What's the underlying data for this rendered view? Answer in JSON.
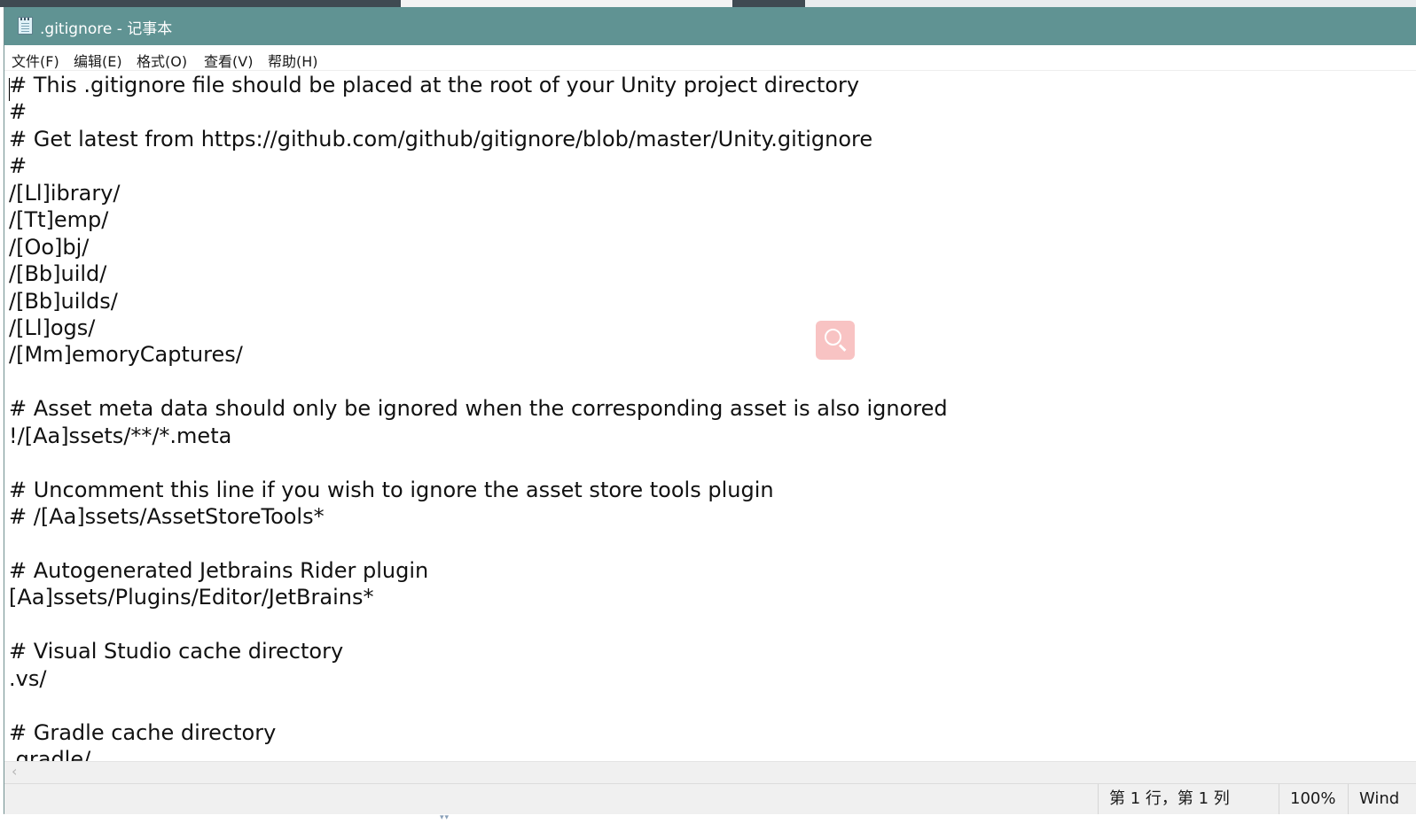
{
  "window": {
    "title": ".gitignore - 记事本",
    "titlebar_color": "#609393"
  },
  "menu": [
    {
      "label": "文件(F)"
    },
    {
      "label": "编辑(E)"
    },
    {
      "label": "格式(O)"
    },
    {
      "label": "查看(V)"
    },
    {
      "label": "帮助(H)"
    }
  ],
  "editor": {
    "lines": [
      "# This .gitignore file should be placed at the root of your Unity project directory",
      "#",
      "# Get latest from https://github.com/github/gitignore/blob/master/Unity.gitignore",
      "#",
      "/[Ll]ibrary/",
      "/[Tt]emp/",
      "/[Oo]bj/",
      "/[Bb]uild/",
      "/[Bb]uilds/",
      "/[Ll]ogs/",
      "/[Mm]emoryCaptures/",
      "",
      "# Asset meta data should only be ignored when the corresponding asset is also ignored",
      "!/[Aa]ssets/**/*.meta",
      "",
      "# Uncomment this line if you wish to ignore the asset store tools plugin",
      "# /[Aa]ssets/AssetStoreTools*",
      "",
      "# Autogenerated Jetbrains Rider plugin",
      "[Aa]ssets/Plugins/Editor/JetBrains*",
      "",
      "# Visual Studio cache directory",
      ".vs/",
      "",
      "# Gradle cache directory",
      ".gradle/"
    ]
  },
  "overlay": {
    "search_icon": "search-icon",
    "badge_color": "#f8c3c3"
  },
  "statusbar": {
    "position": "第 1 行，第 1 列",
    "zoom": "100%",
    "line_ending": "Wind"
  }
}
